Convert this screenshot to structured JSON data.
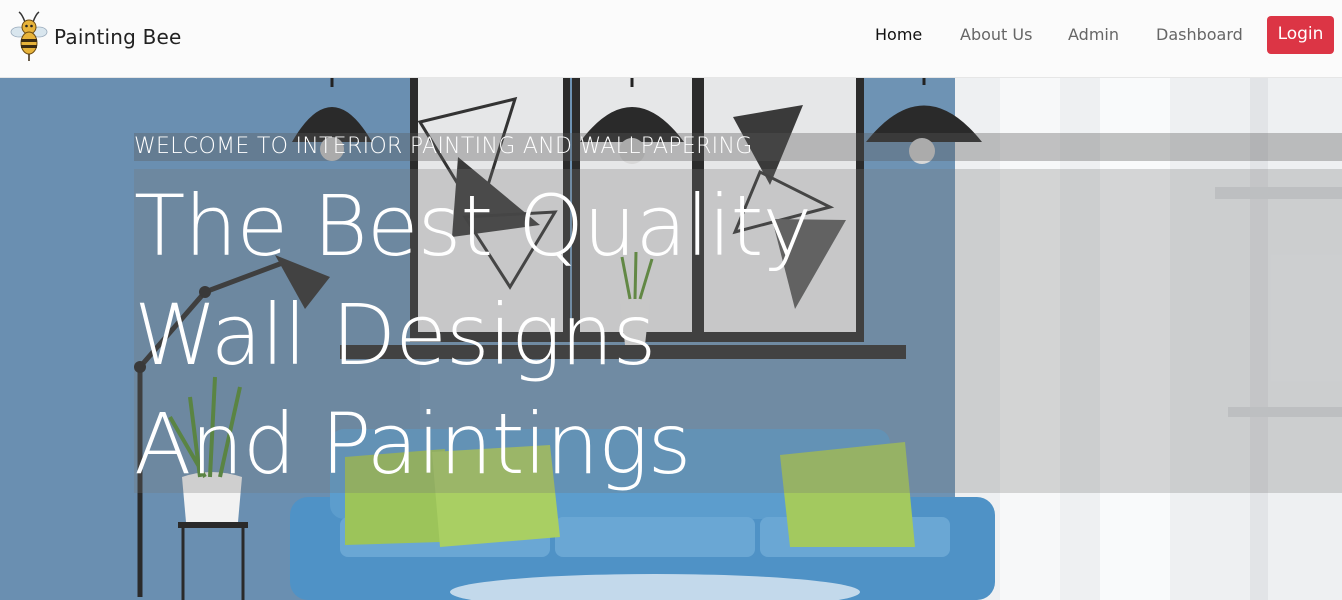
{
  "brand": {
    "name": "Painting Bee",
    "logo_icon": "bee-icon"
  },
  "nav": {
    "items": [
      {
        "label": "Home",
        "active": true
      },
      {
        "label": "About Us"
      },
      {
        "label": "Admin"
      },
      {
        "label": "Dashboard"
      }
    ],
    "login_label": "Login"
  },
  "hero": {
    "welcome": "WELCOME TO INTERIOR PAINTING AND WALLPAPERING",
    "headline_lines": [
      "The Best Quality",
      "Wall Designs",
      "And Paintings"
    ]
  },
  "colors": {
    "accent": "#dc3545",
    "wall": "#6e93b4",
    "sofa": "#4f92c6",
    "pillow": "#9cc45a"
  }
}
